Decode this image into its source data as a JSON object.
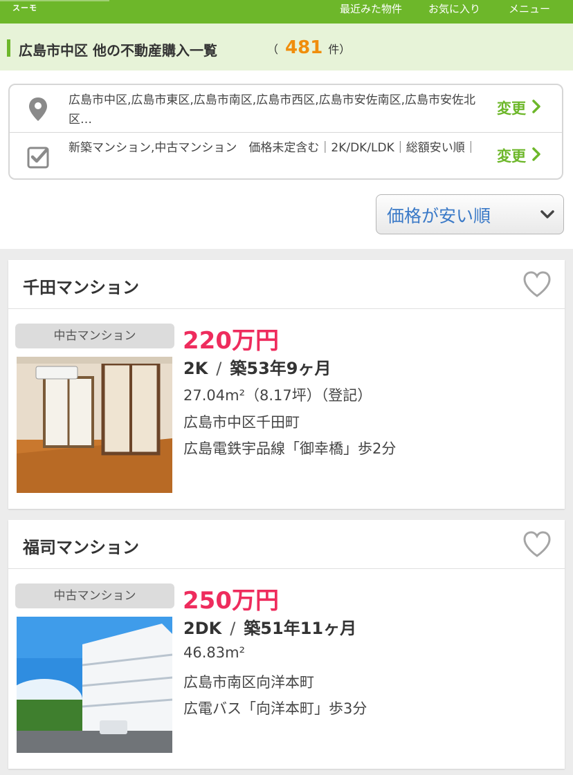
{
  "header": {
    "logo": "スーモ",
    "nav": {
      "recent": "最近みた物件",
      "favorites": "お気に入り",
      "menu": "メニュー"
    }
  },
  "title_bar": {
    "title": "広島市中区 他の不動産購入一覧",
    "count_open": "（",
    "count": "481",
    "count_unit": "件）"
  },
  "conditions": {
    "area_text": "広島市中区,広島市東区,広島市南区,広島市西区,広島市安佐南区,広島市安佐北区…",
    "area_change": "変更",
    "filter_text": "新築マンション,中古マンション　価格未定含む｜2K/DK/LDK｜総額安い順｜",
    "filter_change": "変更"
  },
  "sort": {
    "selected": "価格が安い順"
  },
  "listings": [
    {
      "name": "千田マンション",
      "type": "中古マンション",
      "price": "220万円",
      "layout": "2K",
      "separator": "/",
      "age": "築53年9ヶ月",
      "area": "27.04m²（8.17坪）（登記）",
      "address": "広島市中区千田町",
      "access": "広島電鉄宇品線「御幸橋」歩2分"
    },
    {
      "name": "福司マンション",
      "type": "中古マンション",
      "price": "250万円",
      "layout": "2DK",
      "separator": "/",
      "age": "築51年11ヶ月",
      "area": "46.83m²",
      "address": "広島市南区向洋本町",
      "access": "広電バス「向洋本町」歩3分"
    }
  ],
  "colors": {
    "brand_green": "#6db72a",
    "price_pink": "#ee2c5d",
    "count_orange": "#f08d0c",
    "sort_blue": "#3a79c7"
  }
}
